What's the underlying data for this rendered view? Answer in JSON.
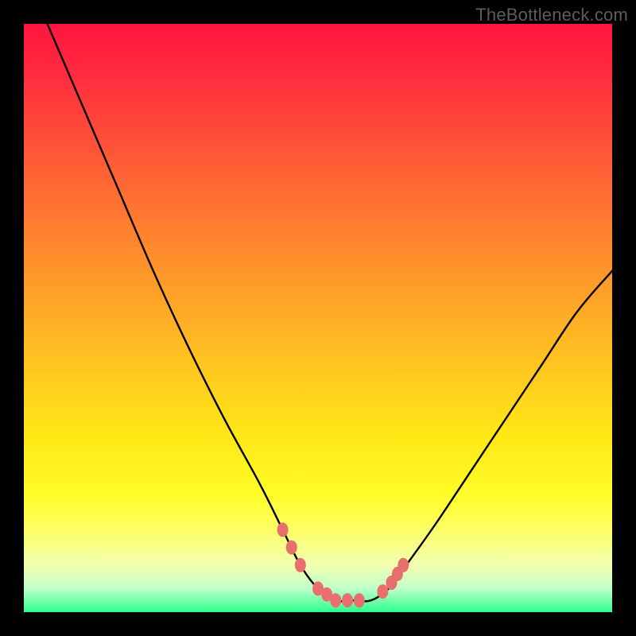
{
  "watermark": "TheBottleneck.com",
  "chart_data": {
    "type": "line",
    "title": "",
    "xlabel": "",
    "ylabel": "",
    "xlim": [
      0,
      100
    ],
    "ylim": [
      0,
      100
    ],
    "series": [
      {
        "name": "bottleneck-curve",
        "x": [
          4,
          10,
          16,
          22,
          28,
          34,
          40,
          44,
          47,
          50,
          53,
          56,
          59,
          62,
          65,
          70,
          76,
          82,
          88,
          94,
          100
        ],
        "values": [
          100,
          86,
          72,
          58,
          45,
          33,
          22,
          14,
          8,
          4,
          2,
          2,
          2,
          4,
          8,
          15,
          24,
          33,
          42,
          51,
          58
        ]
      }
    ],
    "markers": {
      "name": "highlight-points",
      "x": [
        44,
        45.5,
        47,
        50,
        51.5,
        53,
        55,
        57,
        61,
        62.5,
        63.5,
        64.5
      ],
      "values": [
        14,
        11,
        8,
        4,
        3,
        2,
        2,
        2,
        3.5,
        5,
        6.5,
        8
      ]
    }
  }
}
